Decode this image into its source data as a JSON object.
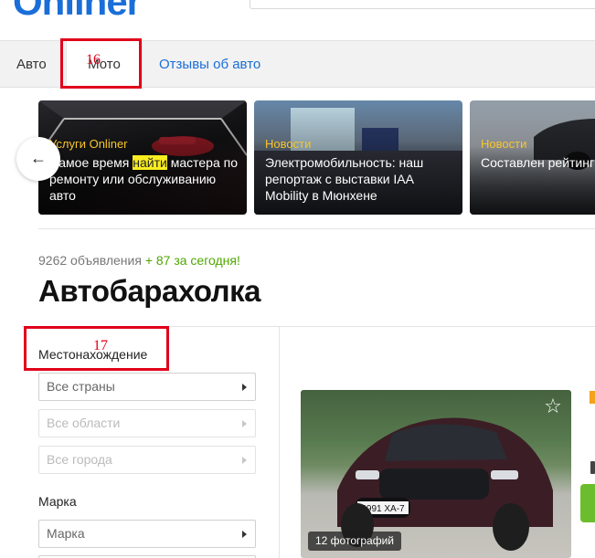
{
  "header": {
    "logo_text": "Onliner"
  },
  "tabs": [
    {
      "label": "Авто"
    },
    {
      "label": "Мото"
    },
    {
      "label": "Отзывы об авто"
    }
  ],
  "annotations": [
    {
      "number": "16"
    },
    {
      "number": "17"
    }
  ],
  "carousel": {
    "prev_icon": "←",
    "cards": [
      {
        "category": "Услуги Onliner",
        "title_before": "Самое время ",
        "title_highlight": "найти",
        "title_after": " мастера по ремонту или обслуживанию авто"
      },
      {
        "category": "Новости",
        "title": "Электромобильность: наш репортаж с выставки IAA Mobility в Мюнхене"
      },
      {
        "category": "Новости",
        "title": "Составлен рейтинг надежных китайских электрокаров. На п"
      }
    ]
  },
  "summary": {
    "count_text": "9262 объявления",
    "today_text": "+ 87 за сегодня!"
  },
  "page_title": "Автобарахолка",
  "filters": {
    "location_label": "Местонахождение",
    "country": "Все страны",
    "region": "Все области",
    "city": "Все города",
    "brand_label": "Марка",
    "brand": "Марка"
  },
  "listing": {
    "photo_count": "12 фотографий",
    "plate": "6991 XA-7",
    "favorite_icon": "☆"
  },
  "colors": {
    "accent": "#1a6ed8",
    "annotation": "#e0001a",
    "category": "#f7c52b",
    "highlight": "#f9ed21",
    "today": "#4fa700"
  }
}
